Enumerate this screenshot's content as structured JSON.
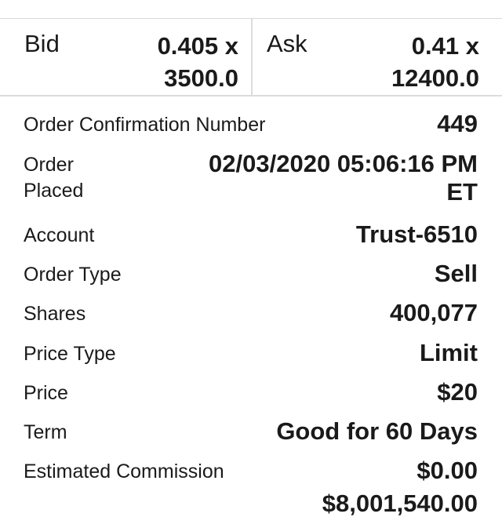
{
  "quote": {
    "bid_label": "Bid",
    "bid_value": "0.405 x\n3500.0",
    "ask_label": "Ask",
    "ask_value": "0.41 x\n12400.0"
  },
  "order": {
    "confirmation_label": "Order Confirmation Number",
    "confirmation_value": "449",
    "placed_label": "Order Placed",
    "placed_value_line1": "02/03/2020 05:06:16 PM",
    "placed_value_line2": "ET",
    "account_label": "Account",
    "account_value": "Trust-6510",
    "type_label": "Order Type",
    "type_value": "Sell",
    "shares_label": "Shares",
    "shares_value": "400,077",
    "price_type_label": "Price Type",
    "price_type_value": "Limit",
    "price_label": "Price",
    "price_value": "$20",
    "term_label": "Term",
    "term_value": "Good for 60 Days",
    "commission_label": "Estimated Commission",
    "commission_value": "$0.00",
    "next_value_partial": "$8,001,540.00"
  }
}
